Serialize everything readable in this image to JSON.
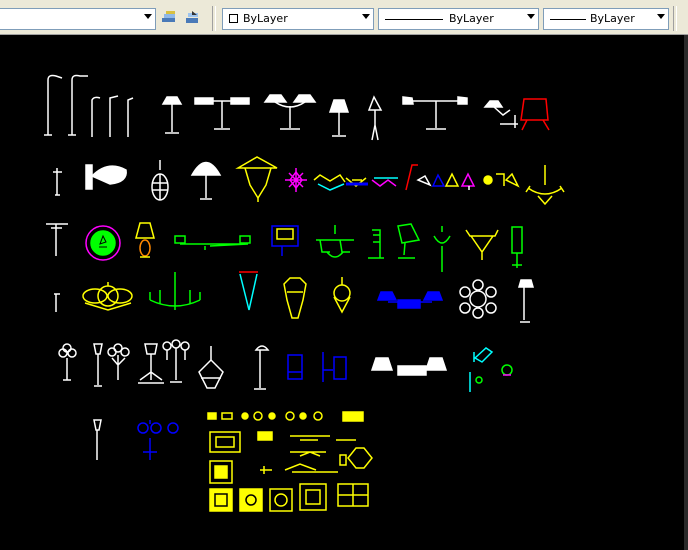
{
  "toolbar": {
    "color_control": {
      "value": "ByLayer",
      "swatch": "#ffffff"
    },
    "linetype_control": {
      "value": "ByLayer"
    },
    "lineweight_control": {
      "value": "ByLayer"
    }
  },
  "icons": {
    "layer_states": "layer-states-icon",
    "layer_previous": "layer-previous-icon"
  },
  "drawing": {
    "background": "#000000",
    "colors": [
      "#ffffff",
      "#ffff00",
      "#00ff00",
      "#0000ff",
      "#ff00ff",
      "#00ffff",
      "#ff0000"
    ]
  }
}
